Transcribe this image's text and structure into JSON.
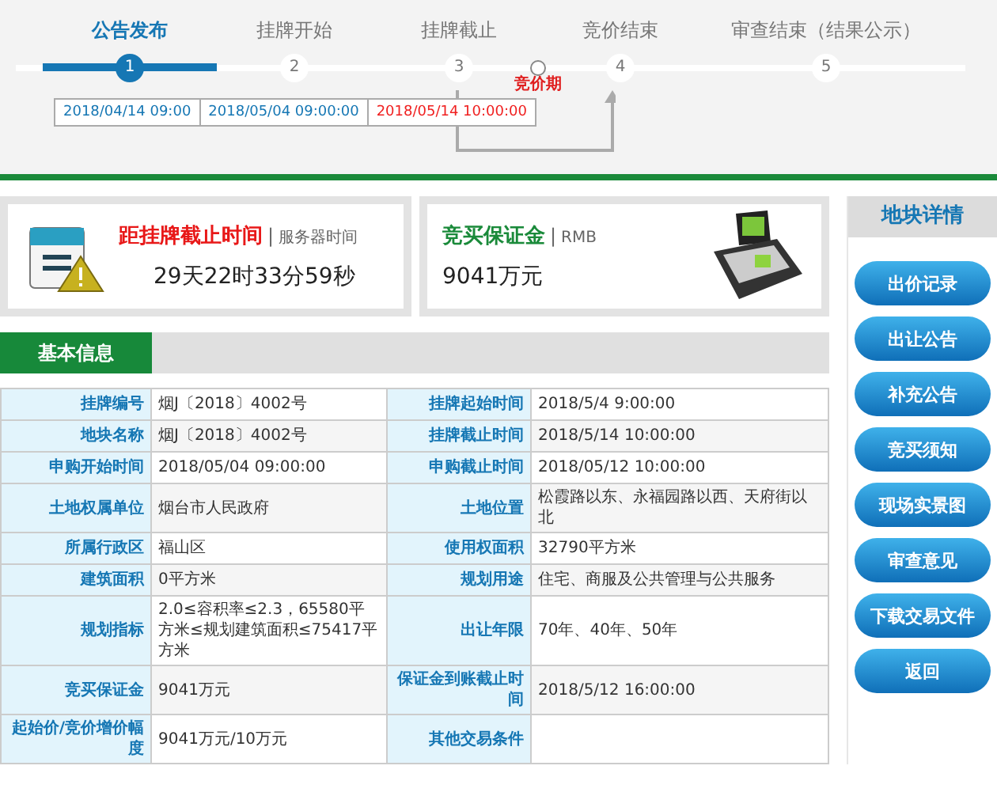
{
  "steps": [
    {
      "label": "公告发布",
      "number": "1",
      "selected": true
    },
    {
      "label": "挂牌开始",
      "number": "2",
      "selected": false
    },
    {
      "label": "挂牌截止",
      "number": "3",
      "selected": false
    },
    {
      "label": "竞价结束",
      "number": "4",
      "selected": false
    },
    {
      "label": "审查结束（结果公示）",
      "number": "5",
      "selected": false
    }
  ],
  "bidding_period": "竞价期",
  "dates": [
    {
      "text": "2018/04/14 09:00",
      "highlight": false
    },
    {
      "text": "2018/05/04 09:00:00",
      "highlight": false
    },
    {
      "text": "2018/05/14 10:00:00",
      "highlight": true
    }
  ],
  "countdown": {
    "title": "距挂牌截止时间",
    "separator": "|",
    "subtitle": "服务器时间",
    "value": "29天22时33分59秒"
  },
  "deposit": {
    "title": "竞买保证金",
    "separator": "|",
    "subtitle": "RMB",
    "value": "9041万元"
  },
  "section_tab": "基本信息",
  "table": {
    "rows": [
      [
        "挂牌编号",
        "烟J〔2018〕4002号",
        "挂牌起始时间",
        "2018/5/4 9:00:00"
      ],
      [
        "地块名称",
        "烟J〔2018〕4002号",
        "挂牌截止时间",
        "2018/5/14 10:00:00"
      ],
      [
        "申购开始时间",
        "2018/05/04 09:00:00",
        "申购截止时间",
        "2018/05/12 10:00:00"
      ],
      [
        "土地权属单位",
        "烟台市人民政府",
        "土地位置",
        "松霞路以东、永福园路以西、天府街以北"
      ],
      [
        "所属行政区",
        "福山区",
        "使用权面积",
        "32790平方米"
      ],
      [
        "建筑面积",
        "0平方米",
        "规划用途",
        "住宅、商服及公共管理与公共服务"
      ],
      [
        "规划指标",
        "2.0≤容积率≤2.3，65580平方米≤规划建筑面积≤75417平方米",
        "出让年限",
        "70年、40年、50年"
      ],
      [
        "竞买保证金",
        "9041万元",
        "保证金到账截止时间",
        "2018/5/12 16:00:00"
      ],
      [
        "起始价/竞价增价幅度",
        "9041万元/10万元",
        "其他交易条件",
        ""
      ]
    ]
  },
  "sidebar": {
    "title": "地块详情",
    "buttons": [
      "出价记录",
      "出让公告",
      "补充公告",
      "竞买须知",
      "现场实景图",
      "审查意见",
      "下载交易文件",
      "返回"
    ]
  }
}
